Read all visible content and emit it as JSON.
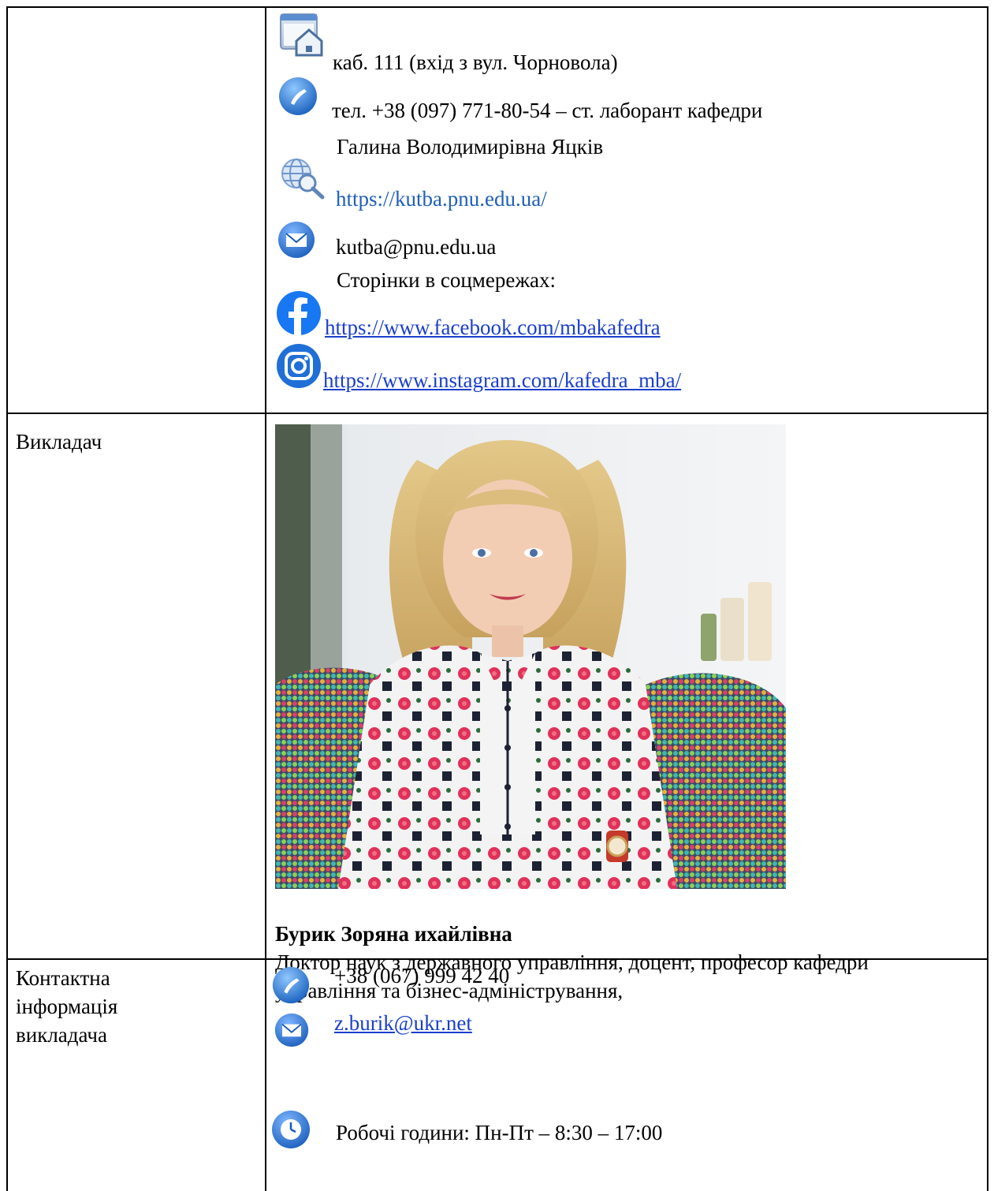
{
  "contacts": {
    "room": "каб. 111 (вхід з вул. Чорновола)",
    "phone_line1": "тел. +38 (097) 771-80-54 –  ст. лаборант кафедри",
    "phone_line2": "Галина Володимирівна Яцків",
    "website": "https://kutba.pnu.edu.ua/",
    "email": "kutba@pnu.edu.ua",
    "social_label": "Сторінки в соцмережах:",
    "facebook": "https://www.facebook.com/mbakafedra",
    "instagram": "https://www.instagram.com/kafedra_mba/"
  },
  "teacher": {
    "row_label": "Викладач",
    "name": "Бурик Зоряна ихайлівна",
    "title_line1": "Доктор наук з державного управління, доцент, професор кафедри",
    "title_line2": "управління та бізнес-адміністрування,"
  },
  "teacher_contacts": {
    "row_label_line1": "Контактна",
    "row_label_line2": "інформація",
    "row_label_line3": "викладача",
    "phone": "+38 (067) 999 42 40",
    "email": "z.burik@ukr.net",
    "hours": "Робочі години: Пн-Пт – 8:30 – 17:00"
  },
  "icons": {
    "building": "building-home-icon",
    "phone": "phone-icon",
    "web": "globe-search-icon",
    "mail": "mail-icon",
    "facebook": "facebook-icon",
    "instagram": "instagram-icon",
    "clock": "clock-icon"
  },
  "colors": {
    "icon_blue": "#1c6fd1",
    "link_blue": "#1f5fb8",
    "link_underline": "#1a3fcc",
    "facebook_blue": "#1877f2"
  }
}
